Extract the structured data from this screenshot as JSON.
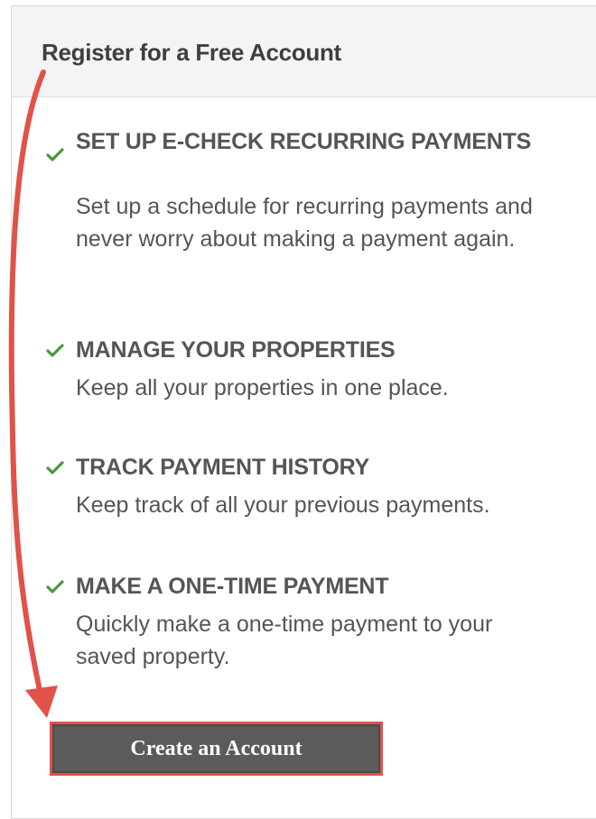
{
  "panel": {
    "title": "Register for a Free Account"
  },
  "features": [
    {
      "title": "SET UP E-CHECK RECURRING PAYMENTS",
      "description": "Set up a schedule for recurring payments and never worry about making a payment again."
    },
    {
      "title": "MANAGE YOUR PROPERTIES",
      "description": "Keep all your properties in one place."
    },
    {
      "title": "TRACK PAYMENT HISTORY",
      "description": "Keep track of all your previous payments."
    },
    {
      "title": "MAKE A ONE-TIME PAYMENT",
      "description": "Quickly make a one-time payment to your saved property."
    }
  ],
  "actions": {
    "create_account_label": "Create an Account"
  },
  "colors": {
    "check": "#4a9a3a",
    "annotation": "#e0524a",
    "button_bg": "#5b5b5b"
  },
  "icons": {
    "feature_bullet": "check-icon",
    "annotation": "arrow-annotation"
  }
}
